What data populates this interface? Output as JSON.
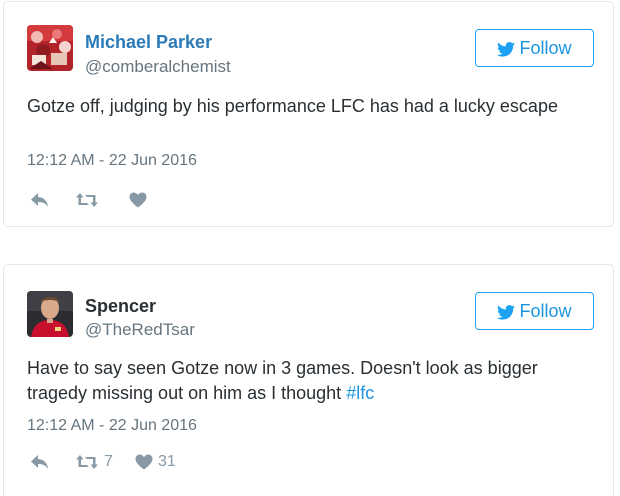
{
  "colors": {
    "name_link": "#2b7bb9",
    "follow_blue": "#1da1f2",
    "hashtag": "#1b95e0",
    "muted_gray": "#66757f",
    "icon_gray": "#8899a6"
  },
  "icons": [
    "twitter-bird-icon",
    "reply-icon",
    "retweet-icon",
    "like-heart-icon"
  ],
  "tweets": [
    {
      "name": "Michael Parker",
      "handle": "@comberalchemist",
      "follow_label": "Follow",
      "text": "Gotze off, judging by his performance LFC has had a lucky escape",
      "hashtag": "",
      "timestamp": "12:12 AM - 22 Jun 2016",
      "retweets": "",
      "likes": ""
    },
    {
      "name": "Spencer",
      "handle": "@TheRedTsar",
      "follow_label": "Follow",
      "text": "Have to say seen Gotze now in 3 games. Doesn't look as bigger tragedy missing out on him as I thought ",
      "hashtag": "#lfc",
      "timestamp": "12:12 AM - 22 Jun 2016",
      "retweets": "7",
      "likes": "31"
    }
  ]
}
